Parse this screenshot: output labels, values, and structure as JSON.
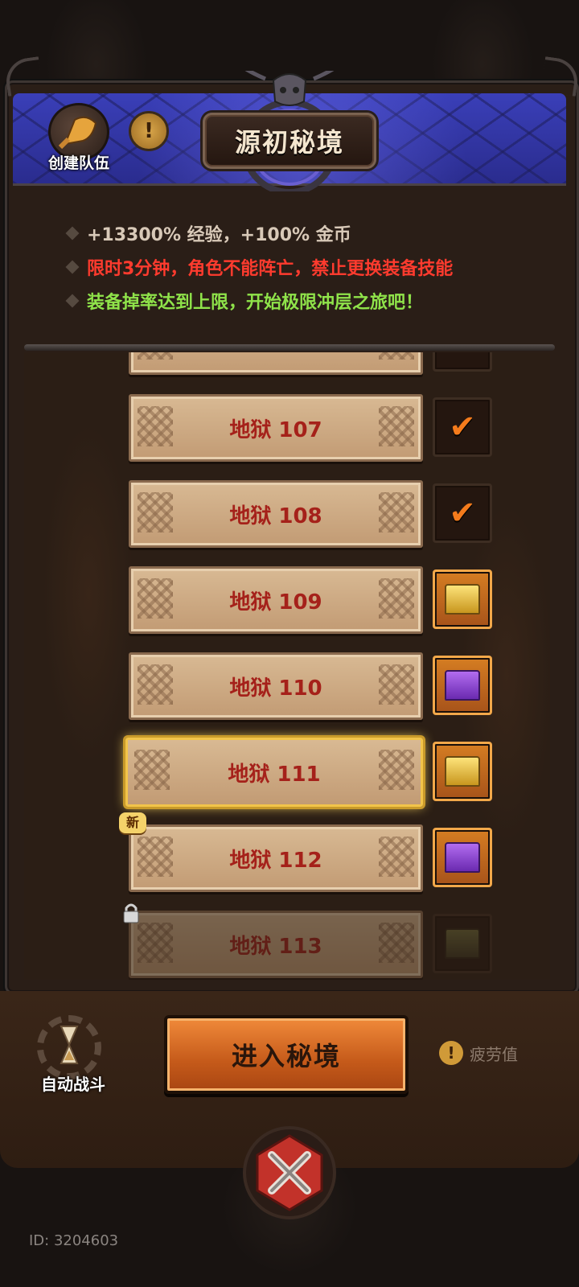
{
  "header": {
    "title": "源初秘境",
    "team_button_label": "创建队伍",
    "info_icon": "!"
  },
  "info": {
    "line1": "+13300% 经验，+100% 金币",
    "line2": "限时3分钟，角色不能阵亡，禁止更换装备技能",
    "line3": "装备掉率达到上限，开始极限冲层之旅吧！",
    "colors": {
      "line1": "#d8c9b8",
      "line2": "#ff3b2e",
      "line3": "#8fe34a"
    }
  },
  "levels": [
    {
      "label": "地狱 107",
      "reward": "checked"
    },
    {
      "label": "地狱 108",
      "reward": "checked"
    },
    {
      "label": "地狱 109",
      "reward": "gold-chest"
    },
    {
      "label": "地狱 110",
      "reward": "purple-chest"
    },
    {
      "label": "地狱 111",
      "reward": "gold-chest",
      "selected": true
    },
    {
      "label": "地狱 112",
      "reward": "purple-chest",
      "badge": "新"
    },
    {
      "label": "地狱 113",
      "reward": "locked-chest",
      "locked": true
    }
  ],
  "bottom": {
    "auto_battle_label": "自动战斗",
    "enter_button_label": "进入秘境",
    "fatigue_label": "疲劳值",
    "fatigue_icon": "!"
  },
  "footer": {
    "id_text": "ID: 3204603"
  },
  "colors": {
    "accent": "#d46d22",
    "level_text": "#a5211a"
  }
}
